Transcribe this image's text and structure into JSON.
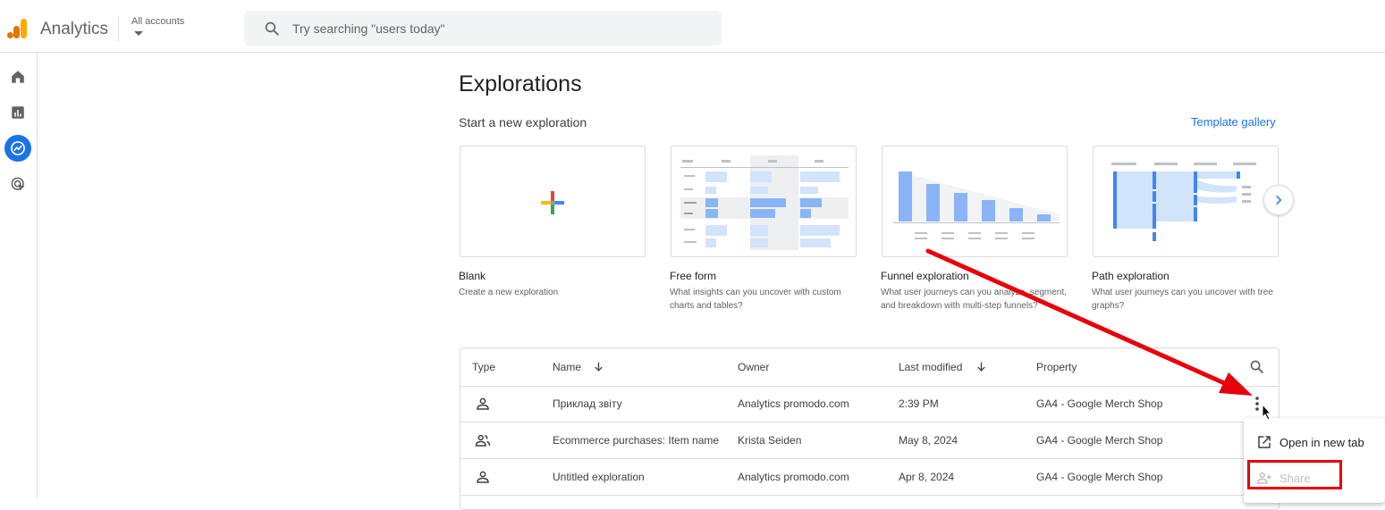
{
  "header": {
    "app_name": "Analytics",
    "account_selector": "All accounts",
    "search_placeholder": "Try searching \"users today\""
  },
  "rail": {
    "items": [
      "home-icon",
      "reports-icon",
      "explore-icon",
      "advertising-icon"
    ],
    "active_index": 2
  },
  "main": {
    "title": "Explorations",
    "start_label": "Start a new exploration",
    "template_gallery": "Template gallery",
    "templates": [
      {
        "title": "Blank",
        "desc": "Create a new exploration"
      },
      {
        "title": "Free form",
        "desc": "What insights can you uncover with custom charts and tables?"
      },
      {
        "title": "Funnel exploration",
        "desc": "What user journeys can you analyze, segment, and breakdown with multi-step funnels?"
      },
      {
        "title": "Path exploration",
        "desc": "What user journeys can you uncover with tree graphs?"
      }
    ]
  },
  "table": {
    "headers": {
      "type": "Type",
      "name": "Name",
      "owner": "Owner",
      "modified": "Last modified",
      "property": "Property"
    },
    "rows": [
      {
        "type": "person-icon",
        "name": "Приклад звіту",
        "owner": "Analytics promodo.com",
        "modified": "2:39 PM",
        "property": "GA4 - Google Merch Shop"
      },
      {
        "type": "people-icon",
        "name": "Ecommerce purchases: Item name",
        "owner": "Krista Seiden",
        "modified": "May 8, 2024",
        "property": "GA4 - Google Merch Shop"
      },
      {
        "type": "person-icon",
        "name": "Untitled exploration",
        "owner": "Analytics promodo.com",
        "modified": "Apr 8, 2024",
        "property": "GA4 - Google Merch Shop"
      }
    ]
  },
  "menu": {
    "open_new_tab": "Open in new tab",
    "share": "Share",
    "share_disabled": true
  },
  "colors": {
    "accent": "#1a73e8",
    "annotation": "#e8000b",
    "chart_blue": "#8ab4f8"
  }
}
